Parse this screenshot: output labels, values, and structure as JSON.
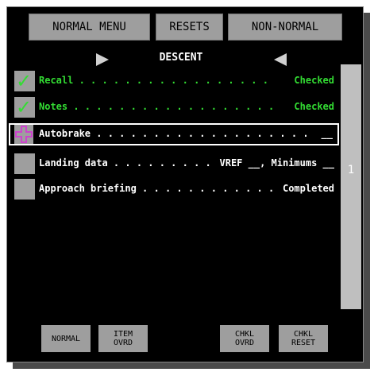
{
  "top_buttons": {
    "normal_menu": "NORMAL MENU",
    "resets": "RESETS",
    "non_normal": "NON-NORMAL"
  },
  "checklist": {
    "title": "DESCENT",
    "items": [
      {
        "label": "Recall . . . . . . . . . . . . . . . . .",
        "value": "Checked",
        "state": "checked",
        "color": "#33dd33"
      },
      {
        "label": "Notes . . . . . . . . . . . . . . . . . .",
        "value": "Checked",
        "state": "checked",
        "color": "#33dd33"
      },
      {
        "label": "Autobrake . . . . . . . . . . . . . . . . . . .",
        "value": "__",
        "state": "current",
        "color": "#ffffff"
      },
      {
        "label": "Landing data . . . . . . . . .",
        "value": "VREF __, Minimums __",
        "state": "open",
        "color": "#ffffff"
      },
      {
        "label": "Approach briefing . . . . . . . . . . . .",
        "value": "Completed",
        "state": "open",
        "color": "#ffffff"
      }
    ]
  },
  "page_number": "1",
  "bottom_buttons": {
    "normal": "NORMAL",
    "item_ovrd": "ITEM\nOVRD",
    "chkl_ovrd": "CHKL\nOVRD",
    "chkl_reset": "CHKL\nRESET"
  },
  "colors": {
    "completed_text": "#33dd33",
    "pending_text": "#ffffff",
    "current_marker": "#cc44cc",
    "button_gray": "#9e9e9e"
  },
  "icons": {
    "checked_marker": "checkmark-icon",
    "current_marker": "cross-marker-icon",
    "prev": "left-arrow-icon",
    "next": "right-arrow-icon"
  }
}
